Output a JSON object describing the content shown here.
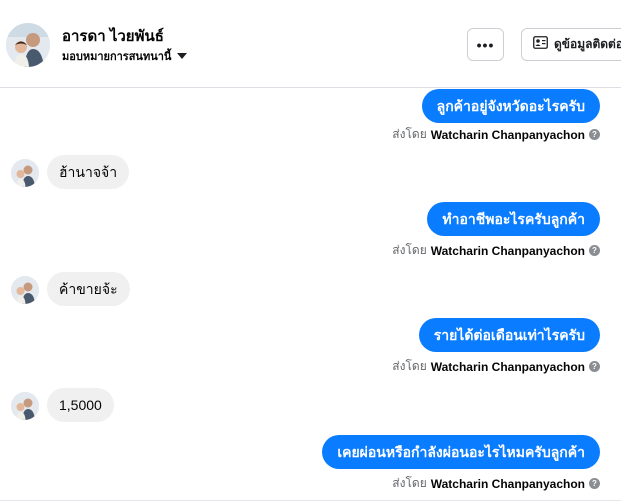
{
  "header": {
    "name": "อารดา ไวยพันธ์",
    "assign_label": "มอบหมายการสนทนานี้",
    "contact_button_label": "ดูข้อมูลติดต่อ"
  },
  "messages": [
    {
      "direction": "out",
      "text": "ลูกค้าอยู่จังหวัดอะไรครับ",
      "sent_by_prefix": "ส่งโดย",
      "sender": "Watcharin Chanpanyachon"
    },
    {
      "direction": "in",
      "text": "ฮ้านาจจ้า"
    },
    {
      "direction": "out",
      "text": "ทำอาชีพอะไรครับลูกค้า",
      "sent_by_prefix": "ส่งโดย",
      "sender": "Watcharin Chanpanyachon"
    },
    {
      "direction": "in",
      "text": "ค้าขายจ้ะ"
    },
    {
      "direction": "out",
      "text": "รายได้ต่อเดือนเท่าไรครับ",
      "sent_by_prefix": "ส่งโดย",
      "sender": "Watcharin Chanpanyachon"
    },
    {
      "direction": "in",
      "text": "1,5000"
    },
    {
      "direction": "out",
      "text": "เคยผ่อนหรือกำลังผ่อนอะไรไหมครับลูกค้า",
      "sent_by_prefix": "ส่งโดย",
      "sender": "Watcharin Chanpanyachon"
    }
  ],
  "icons": {
    "more": "more-dots-icon",
    "contact": "contact-card-icon",
    "caret": "caret-down-icon",
    "help": "help-circle-icon"
  },
  "colors": {
    "outgoing_bubble": "#0a7cff",
    "incoming_bubble": "#f0f0f0",
    "secondary_text": "#65676b"
  }
}
